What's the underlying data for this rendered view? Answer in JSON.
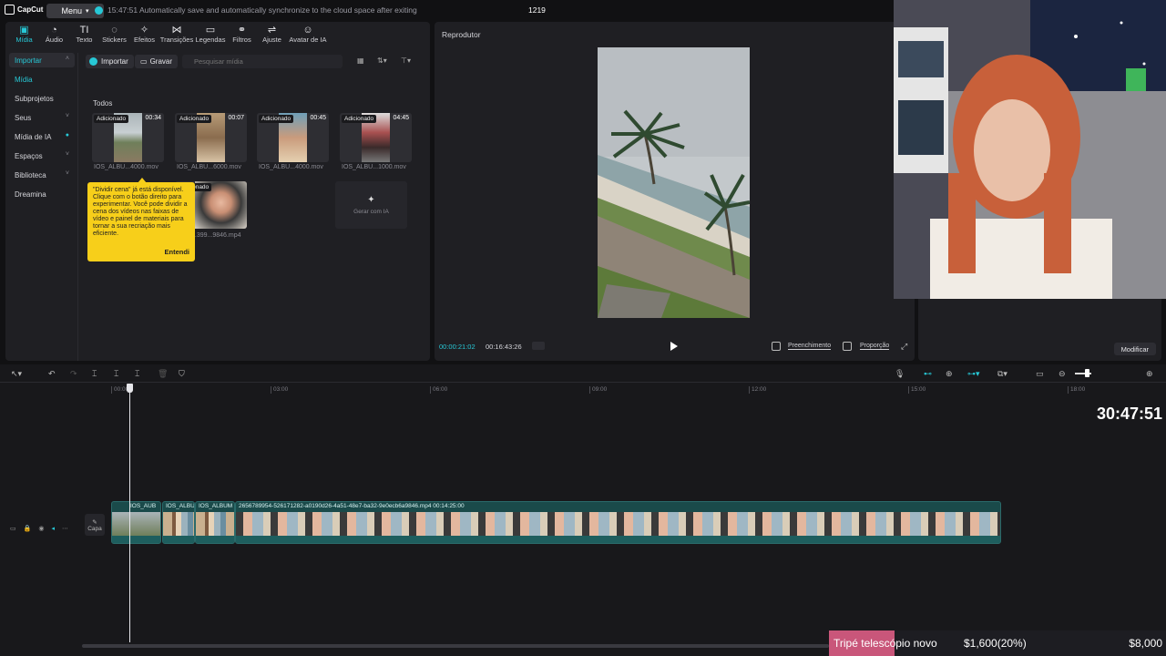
{
  "topbar": {
    "logo": "CapCut",
    "menu": "Menu",
    "autosave": "15:47:51 Automatically save and automatically synchronize to the cloud space after exiting",
    "project": "1219"
  },
  "tools": [
    {
      "label": "Mídia",
      "icon": "media-icon"
    },
    {
      "label": "Áudio",
      "icon": "audio-icon"
    },
    {
      "label": "Texto",
      "icon": "text-icon"
    },
    {
      "label": "Stickers",
      "icon": "sticker-icon"
    },
    {
      "label": "Efeitos",
      "icon": "effects-icon"
    },
    {
      "label": "Transições",
      "icon": "transitions-icon"
    },
    {
      "label": "Legendas",
      "icon": "captions-icon"
    },
    {
      "label": "Filtros",
      "icon": "filters-icon"
    },
    {
      "label": "Ajuste",
      "icon": "adjust-icon"
    },
    {
      "label": "Avatar de IA",
      "icon": "avatar-icon"
    }
  ],
  "sidenav": [
    {
      "label": "Importar",
      "chevron": "^"
    },
    {
      "label": "Mídia",
      "chevron": ""
    },
    {
      "label": "Subprojetos",
      "chevron": ""
    },
    {
      "label": "Seus",
      "chevron": "v"
    },
    {
      "label": "Mídia de IA",
      "chevron": ""
    },
    {
      "label": "Espaços",
      "chevron": "v"
    },
    {
      "label": "Biblioteca",
      "chevron": "v"
    },
    {
      "label": "Dreamina",
      "chevron": ""
    }
  ],
  "media": {
    "import_btn": "Importar",
    "record_btn": "Gravar",
    "search_placeholder": "Pesquisar mídia",
    "section": "Todos",
    "added_tag": "Adicionado",
    "gen_ai": "Gerar com IA",
    "items": [
      {
        "duration": "00:34",
        "name": "IOS_ALBU...4000.mov"
      },
      {
        "duration": "00:07",
        "name": "IOS_ALBU...6000.mov"
      },
      {
        "duration": "00:45",
        "name": "IOS_ALBU...4000.mov"
      },
      {
        "duration": "04:45",
        "name": "IOS_ALBU...1000.mov"
      },
      {
        "duration": "",
        "name": "...399...9846.mp4"
      }
    ]
  },
  "tooltip": {
    "text": "\"Dividir cena\" já está disponível. Clique com o botão direito para experimentar. Você pode dividir a cena dos vídeos nas faixas de vídeo e painel de materiais para tornar a sua recriação mais eficiente.",
    "button": "Entendi"
  },
  "player": {
    "title": "Reprodutor",
    "current": "00:00:21:02",
    "total": "00:16:43:26",
    "fill": "Preenchimento",
    "ratio": "Proporção"
  },
  "inspector": {
    "modify": "Modificar"
  },
  "timeline": {
    "ticks": [
      "00:00",
      "03:00",
      "06:00",
      "09:00",
      "12:00",
      "15:00",
      "18:00"
    ],
    "clips": [
      {
        "label": "IOS_AUB"
      },
      {
        "label": "IOS_ALBU"
      },
      {
        "label": "IOS_ALBUM"
      },
      {
        "label": "2656789954-526171282-a0190d26-4a51-48e7-ba32-9e0ecb6a9846.mp4  00:14:25:00"
      }
    ],
    "cover": "Capa"
  },
  "stream": {
    "timer": "30:47:51",
    "goal_name": "Tripé telescópio novo",
    "goal_progress": "$1,600(20%)",
    "goal_total": "$8,000"
  },
  "colors": {
    "accent": "#27c8d6",
    "tooltip": "#f7cf1a",
    "goal": "#c9567a"
  }
}
